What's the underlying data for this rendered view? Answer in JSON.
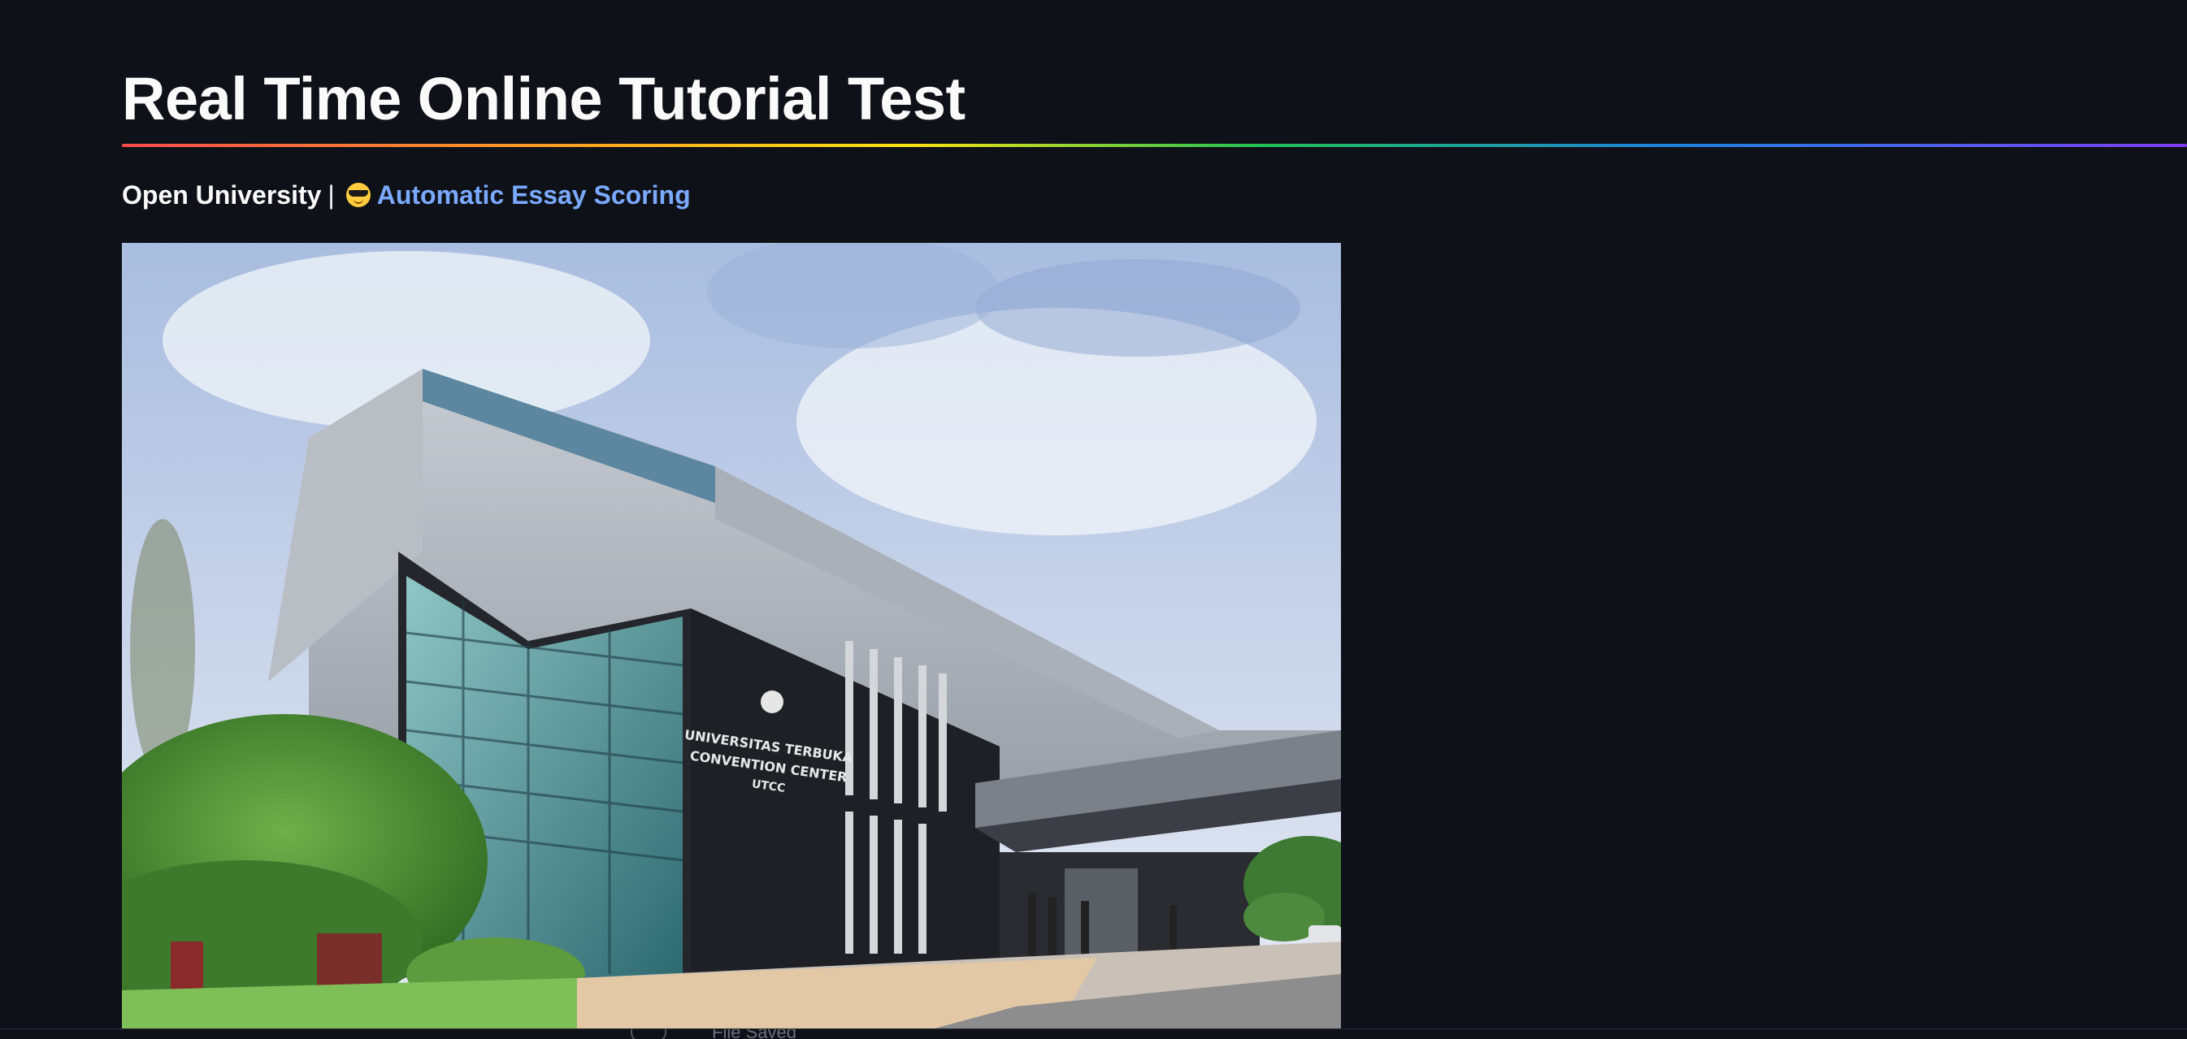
{
  "app": {
    "title": "Real Time Online Tutorial Test"
  },
  "subheader": {
    "org": "Open University",
    "separator": "|",
    "emoji_icon": "smiling-face-with-sunglasses-icon",
    "link_label": "Automatic Essay Scoring"
  },
  "image": {
    "building_sign_line1": "UNIVERSITAS TERBUKA",
    "building_sign_line2": "CONVENTION CENTER",
    "building_sign_line3": "UTCC"
  },
  "status_bar": {
    "status_text": "File Saved"
  },
  "colors": {
    "background": "#0e1117",
    "text": "#fafafa",
    "link": "#7aa9ff"
  }
}
